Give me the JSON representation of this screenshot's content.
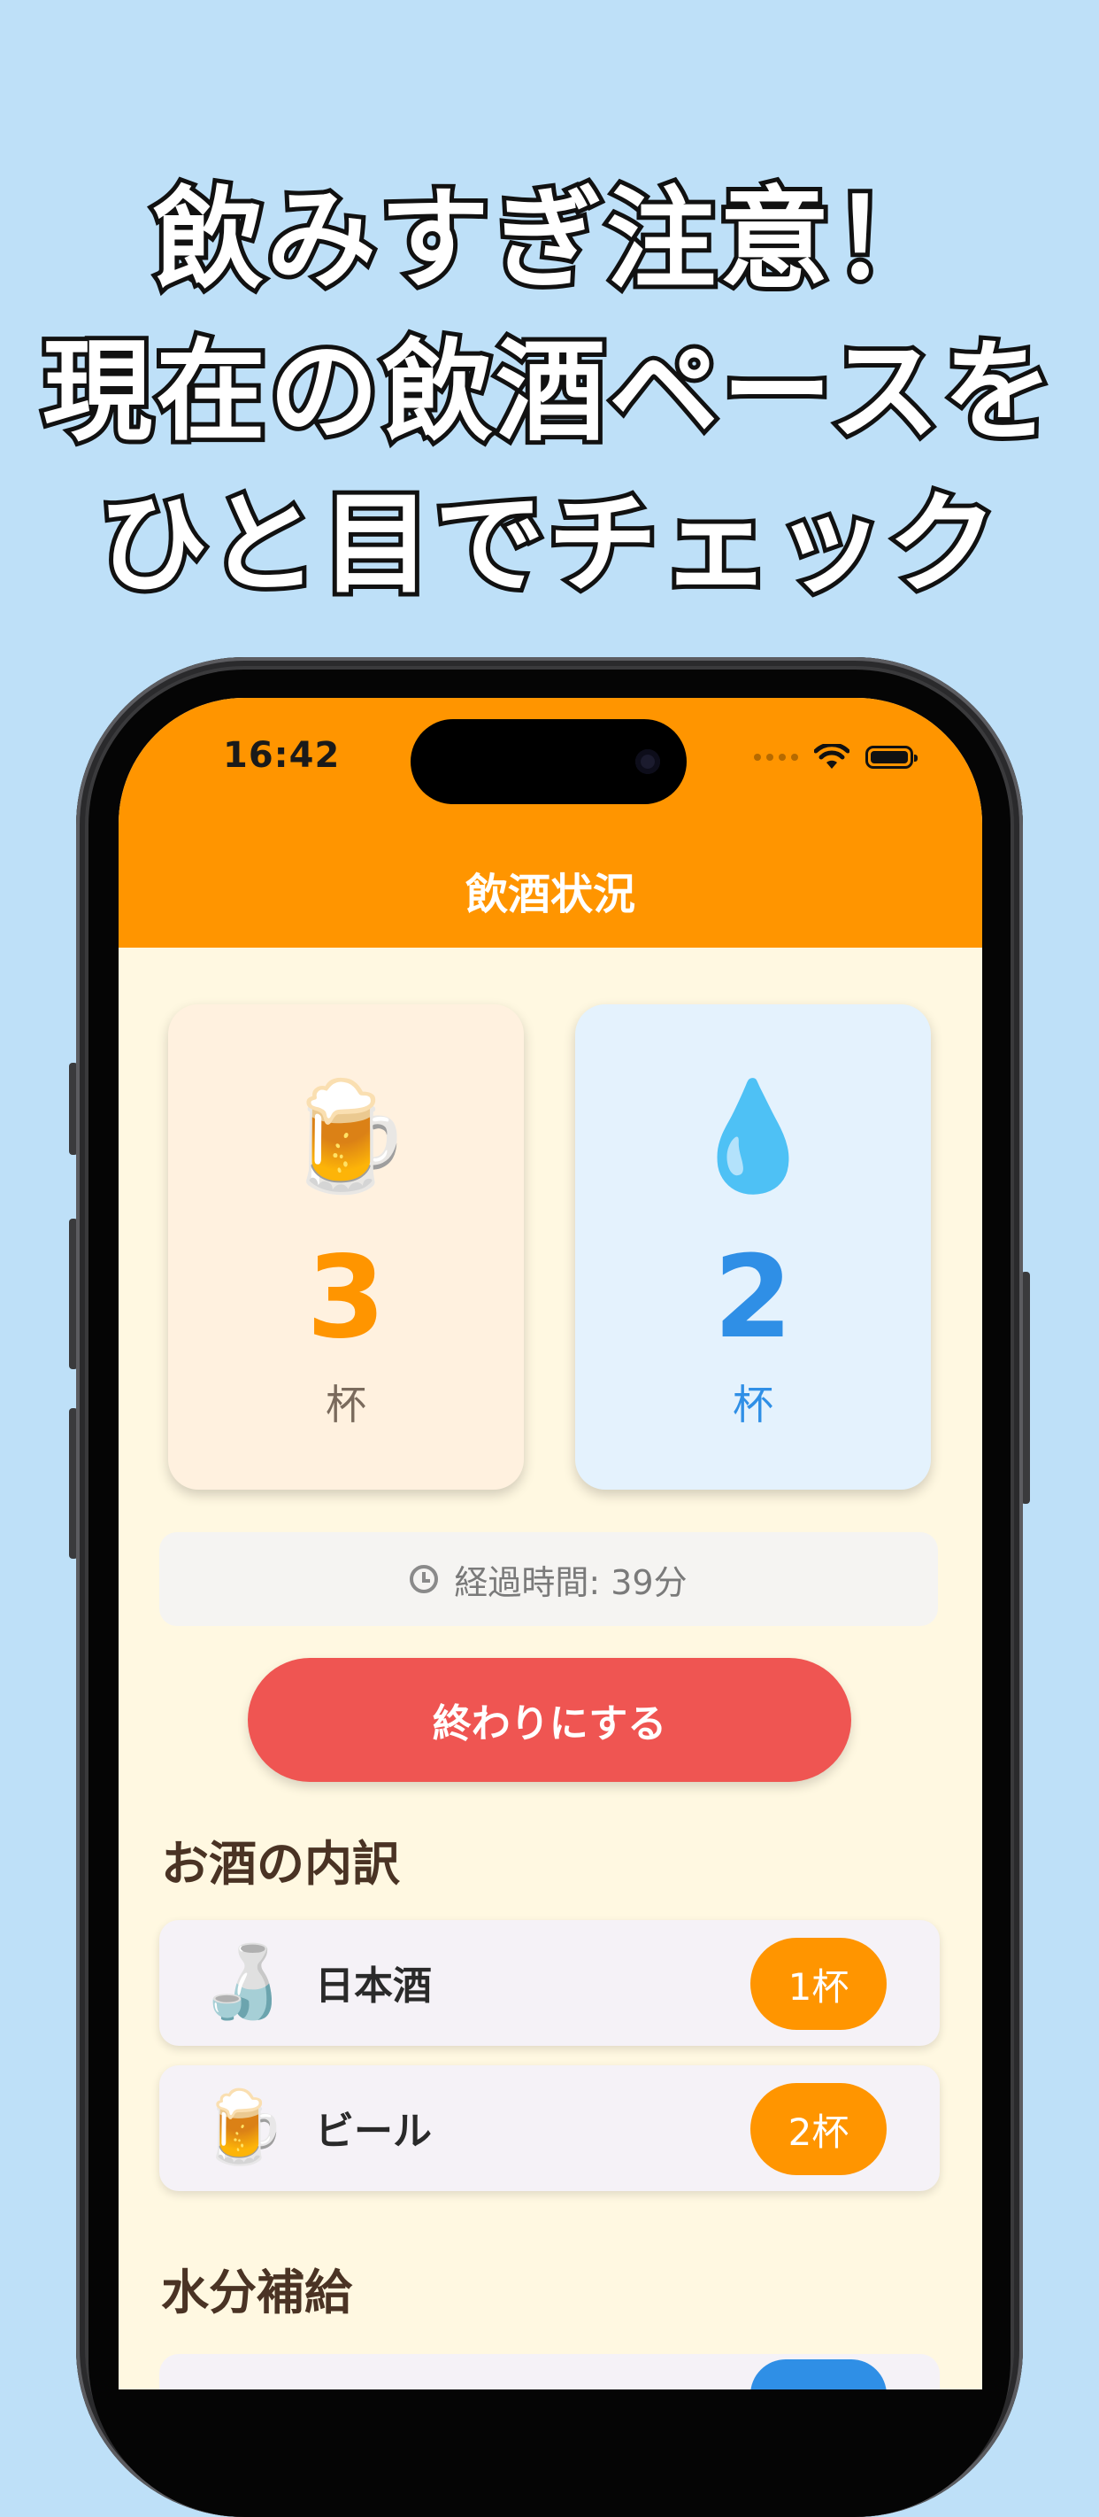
{
  "headline": {
    "line1": "飲みすぎ注意！",
    "line2": "現在の飲酒ペースを",
    "line3": "ひと目でチェック"
  },
  "status_bar": {
    "time": "16:42",
    "icons": [
      "signal-dots-icon",
      "wifi-icon",
      "battery-icon"
    ]
  },
  "nav": {
    "title": "飲酒状況"
  },
  "cards": {
    "alcohol": {
      "icon": "🍺",
      "icon_name": "beer-mug-icon",
      "count": "3",
      "unit": "杯",
      "color": "#ff9500",
      "bg": "#fff1df"
    },
    "water": {
      "icon": "💧",
      "icon_name": "water-drop-icon",
      "count": "2",
      "unit": "杯",
      "color": "#2f8fe6",
      "bg": "#e4f2fd"
    }
  },
  "elapsed": {
    "icon": "clock-icon",
    "text": "経過時間: 39分"
  },
  "end_button": {
    "label": "終わりにする",
    "color": "#ef5552"
  },
  "alcohol_breakdown": {
    "title": "お酒の内訳",
    "items": [
      {
        "icon": "🍶",
        "icon_name": "sake-bottle-icon",
        "label": "日本酒",
        "count": "1杯"
      },
      {
        "icon": "🍺",
        "icon_name": "beer-mug-icon",
        "label": "ビール",
        "count": "2杯"
      }
    ]
  },
  "hydration": {
    "title": "水分補給"
  },
  "colors": {
    "background": "#bee0f8",
    "accent": "#ff9500",
    "screen_bg": "#fff8e1"
  }
}
